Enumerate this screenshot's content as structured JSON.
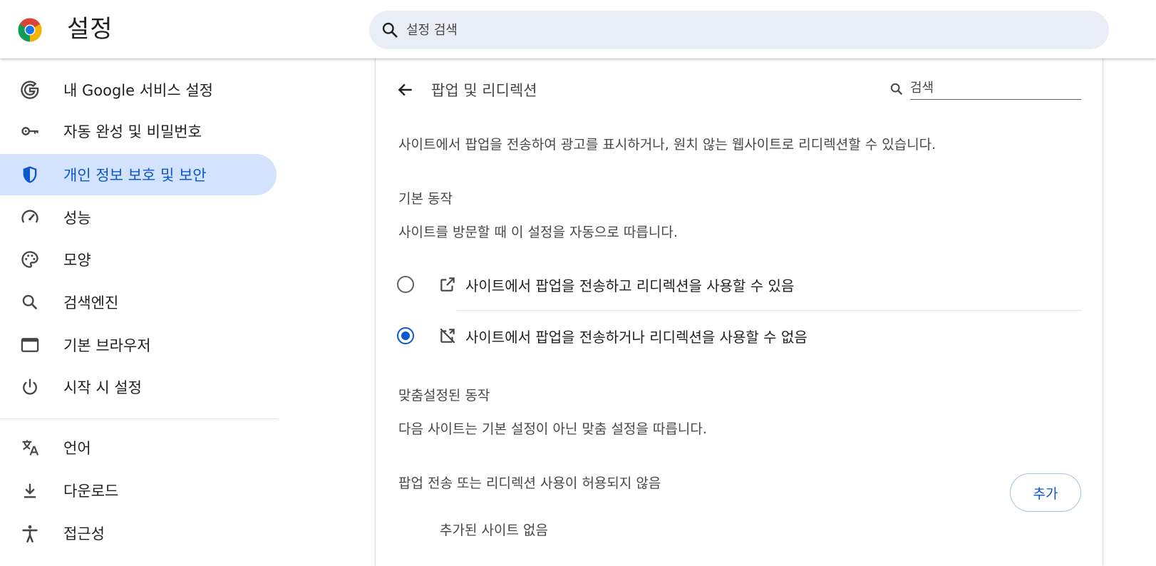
{
  "header": {
    "title": "설정",
    "search_placeholder": "설정 검색"
  },
  "sidebar": {
    "items": [
      {
        "label": "내 Google 서비스 설정",
        "icon": "google-g-icon"
      },
      {
        "label": "자동 완성 및 비밀번호",
        "icon": "key-icon"
      },
      {
        "label": "개인 정보 보호 및 보안",
        "icon": "shield-icon",
        "active": true
      },
      {
        "label": "성능",
        "icon": "speedometer-icon"
      },
      {
        "label": "모양",
        "icon": "palette-icon"
      },
      {
        "label": "검색엔진",
        "icon": "search-icon"
      },
      {
        "label": "기본 브라우저",
        "icon": "browser-window-icon"
      },
      {
        "label": "시작 시 설정",
        "icon": "power-icon"
      },
      {
        "label": "언어",
        "icon": "translate-icon"
      },
      {
        "label": "다운로드",
        "icon": "download-icon"
      },
      {
        "label": "접근성",
        "icon": "accessibility-icon"
      }
    ]
  },
  "main": {
    "title": "팝업 및 리디렉션",
    "search_placeholder": "검색",
    "description": "사이트에서 팝업을 전송하여 광고를 표시하거나, 원치 않는 웹사이트로 리디렉션할 수 있습니다.",
    "default_behavior": {
      "heading": "기본 동작",
      "description": "사이트를 방문할 때 이 설정을 자동으로 따릅니다.",
      "options": [
        {
          "label": "사이트에서 팝업을 전송하고 리디렉션을 사용할 수 있음",
          "icon": "open-in-new-icon",
          "checked": false
        },
        {
          "label": "사이트에서 팝업을 전송하거나 리디렉션을 사용할 수 없음",
          "icon": "popup-blocked-icon",
          "checked": true
        }
      ]
    },
    "custom_behavior": {
      "heading": "맞춤설정된 동작",
      "description": "다음 사이트는 기본 설정이 아닌 맞춤 설정을 따릅니다.",
      "blocked_label": "팝업 전송 또는 리디렉션 사용이 허용되지 않음",
      "add_button": "추가",
      "empty_text": "추가된 사이트 없음"
    }
  },
  "colors": {
    "accent": "#0b57d0",
    "active_nav_bg": "#d3e3fd",
    "search_bg": "#e9eef6"
  }
}
